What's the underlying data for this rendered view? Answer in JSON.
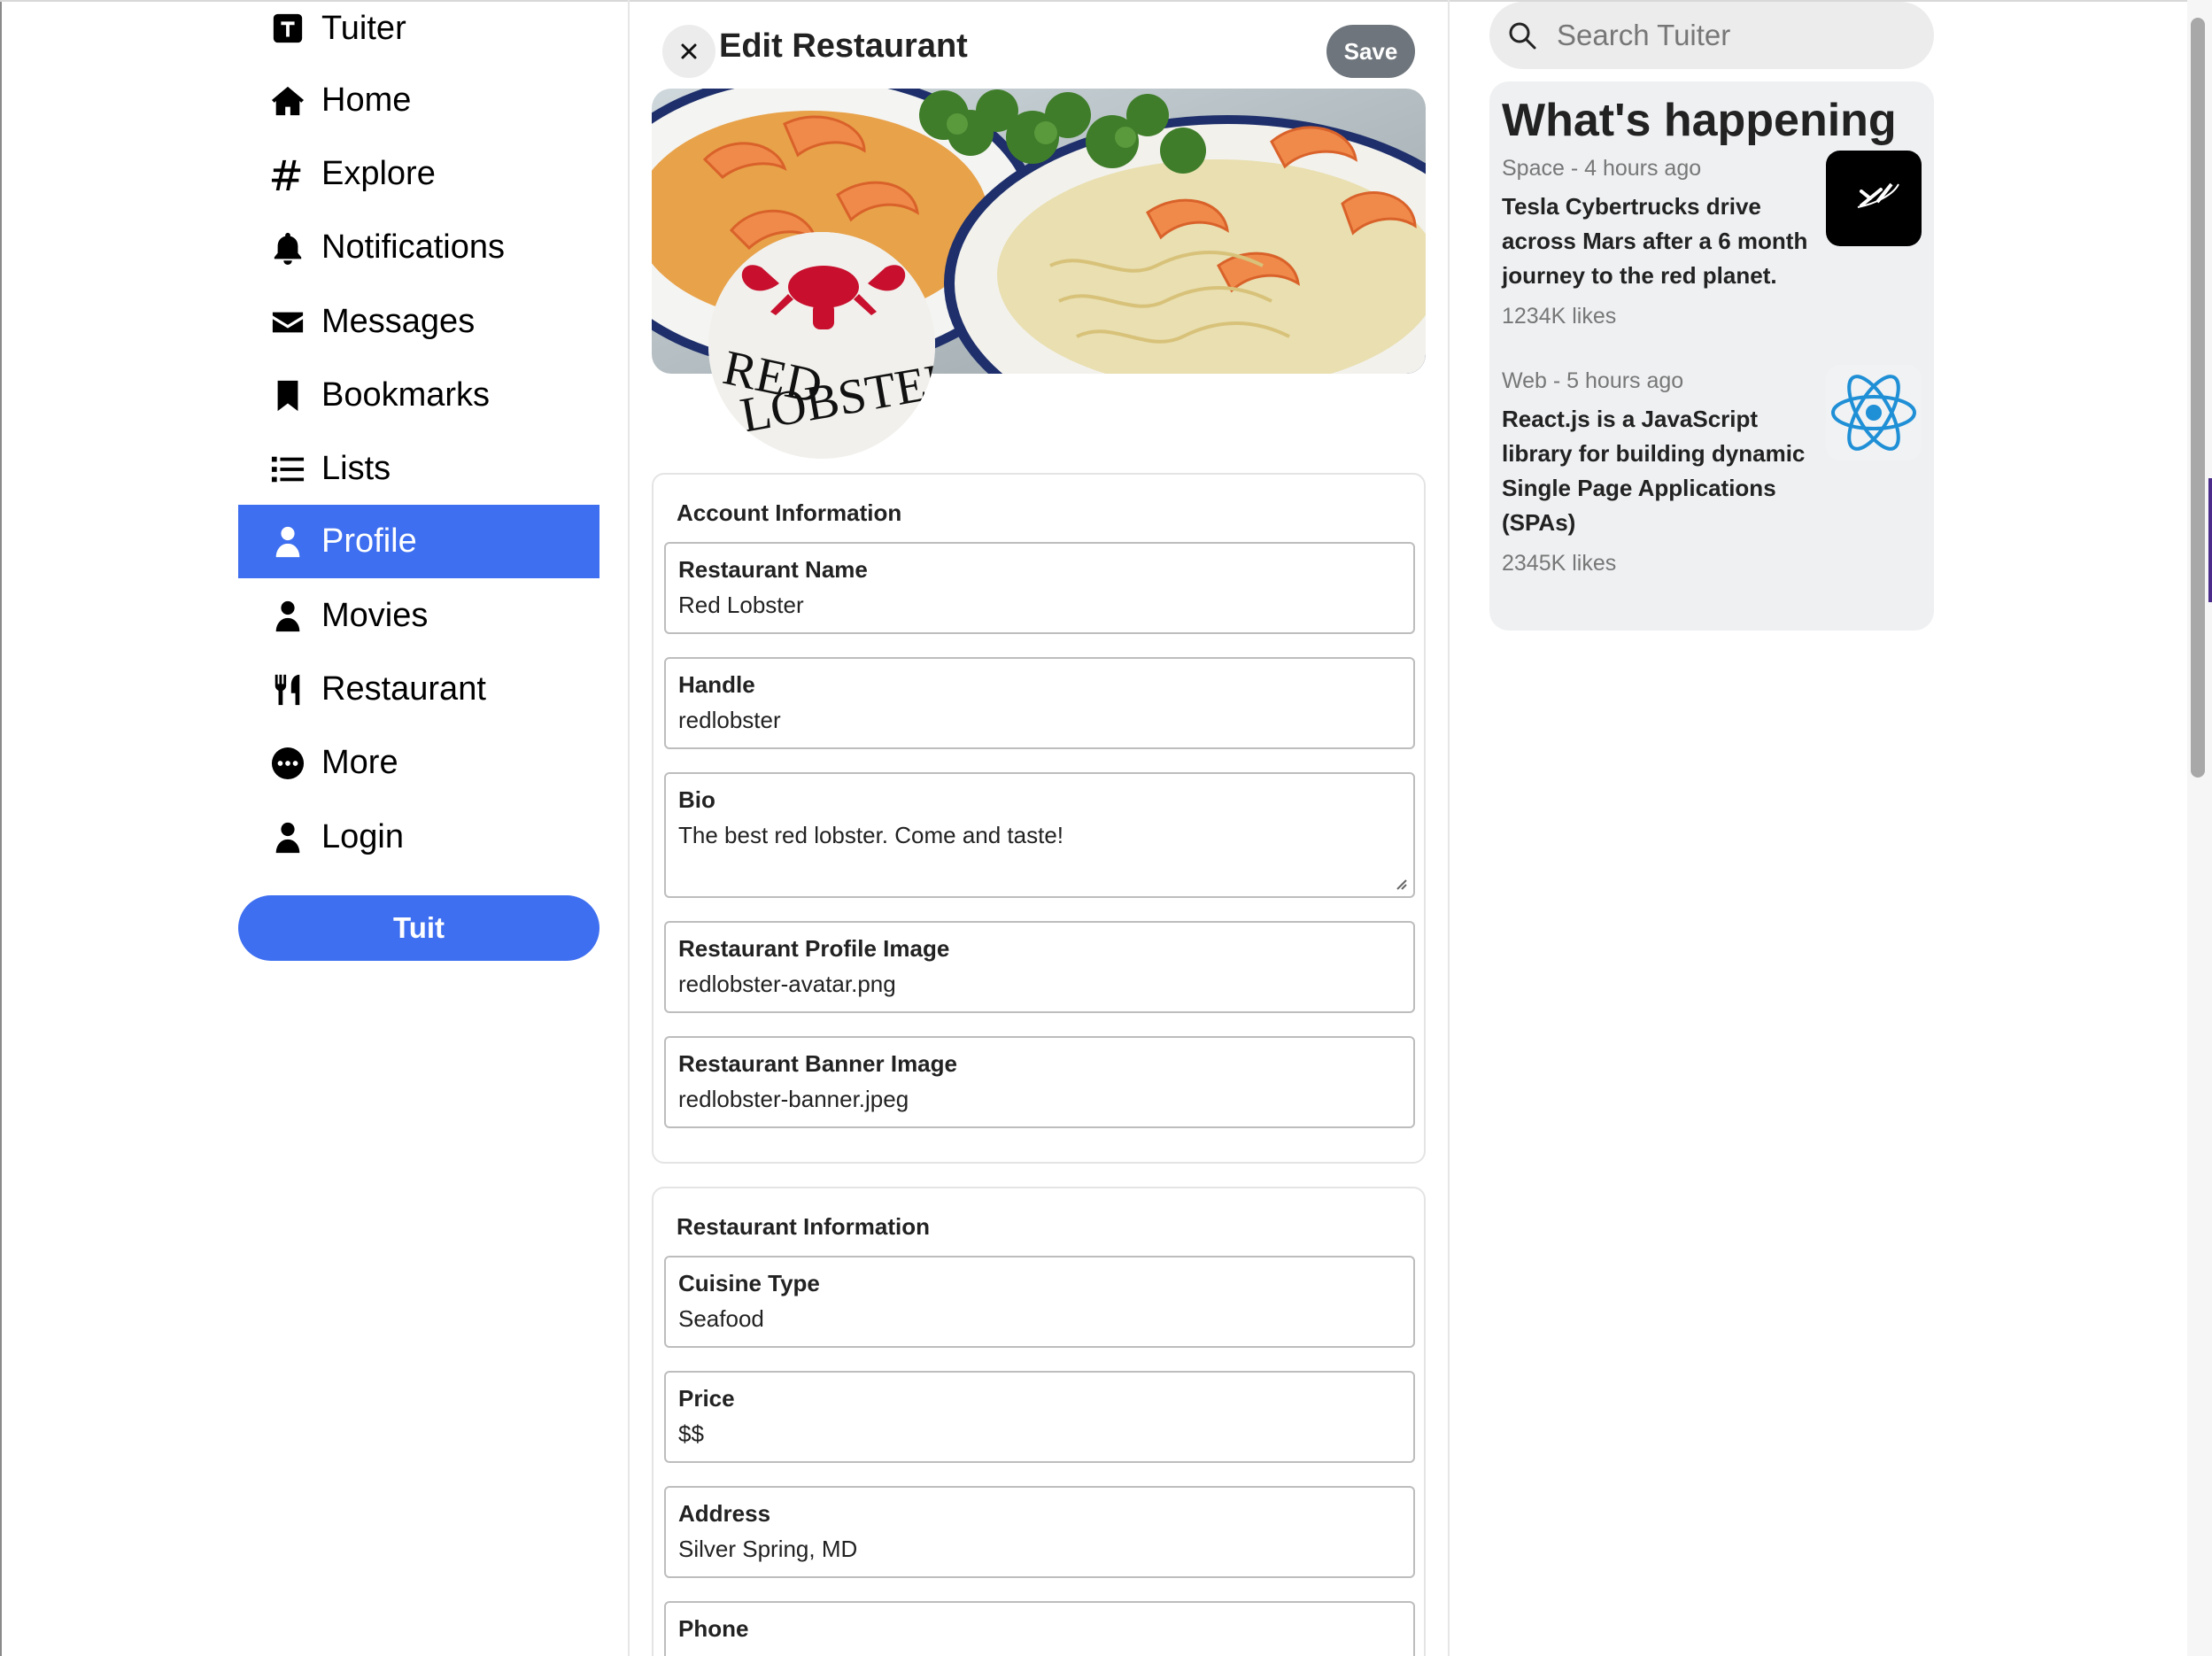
{
  "sidebar": {
    "brand": {
      "label": "Tuiter",
      "icon": "tuiter-logo-icon"
    },
    "items": [
      {
        "label": "Home",
        "icon": "home-icon"
      },
      {
        "label": "Explore",
        "icon": "hashtag-icon"
      },
      {
        "label": "Notifications",
        "icon": "bell-icon"
      },
      {
        "label": "Messages",
        "icon": "envelope-icon"
      },
      {
        "label": "Bookmarks",
        "icon": "bookmark-icon"
      },
      {
        "label": "Lists",
        "icon": "list-icon"
      },
      {
        "label": "Profile",
        "icon": "user-icon",
        "active": true
      },
      {
        "label": "Movies",
        "icon": "user-icon"
      },
      {
        "label": "Restaurant",
        "icon": "utensils-icon"
      },
      {
        "label": "More",
        "icon": "ellipsis-circle-icon"
      },
      {
        "label": "Login",
        "icon": "user-icon"
      }
    ],
    "tuit_button": "Tuit"
  },
  "header": {
    "title": "Edit Restaurant",
    "save_label": "Save"
  },
  "banner": {
    "logo_text_line1": "RED",
    "logo_text_line2": "LOBSTER"
  },
  "account_info": {
    "title": "Account Information",
    "fields": [
      {
        "label": "Restaurant Name",
        "value": "Red Lobster"
      },
      {
        "label": "Handle",
        "value": "redlobster"
      },
      {
        "label": "Bio",
        "value": "The best red lobster. Come and taste!"
      },
      {
        "label": "Restaurant Profile Image",
        "value": "redlobster-avatar.png"
      },
      {
        "label": "Restaurant Banner Image",
        "value": "redlobster-banner.jpeg"
      }
    ]
  },
  "restaurant_info": {
    "title": "Restaurant Information",
    "fields": [
      {
        "label": "Cuisine Type",
        "value": "Seafood"
      },
      {
        "label": "Price",
        "value": "$$"
      },
      {
        "label": "Address",
        "value": "Silver Spring, MD"
      },
      {
        "label": "Phone",
        "value": ""
      }
    ]
  },
  "search": {
    "placeholder": "Search Tuiter"
  },
  "whats_happening": {
    "title": "What's happening",
    "trends": [
      {
        "meta": "Space - 4 hours ago",
        "text": "Tesla Cybertrucks drive across Mars after a 6 month journey to the red planet.",
        "likes": "1234K likes",
        "thumb": "spacex-logo-icon"
      },
      {
        "meta": "Web - 5 hours ago",
        "text": "React.js is a JavaScript library for building dynamic Single Page Applications (SPAs)",
        "likes": "2345K likes",
        "thumb": "react-logo-icon"
      }
    ]
  },
  "colors": {
    "accent": "#3e6ff0",
    "save_button": "#6e757c",
    "panel_bg": "#eef0f2"
  }
}
